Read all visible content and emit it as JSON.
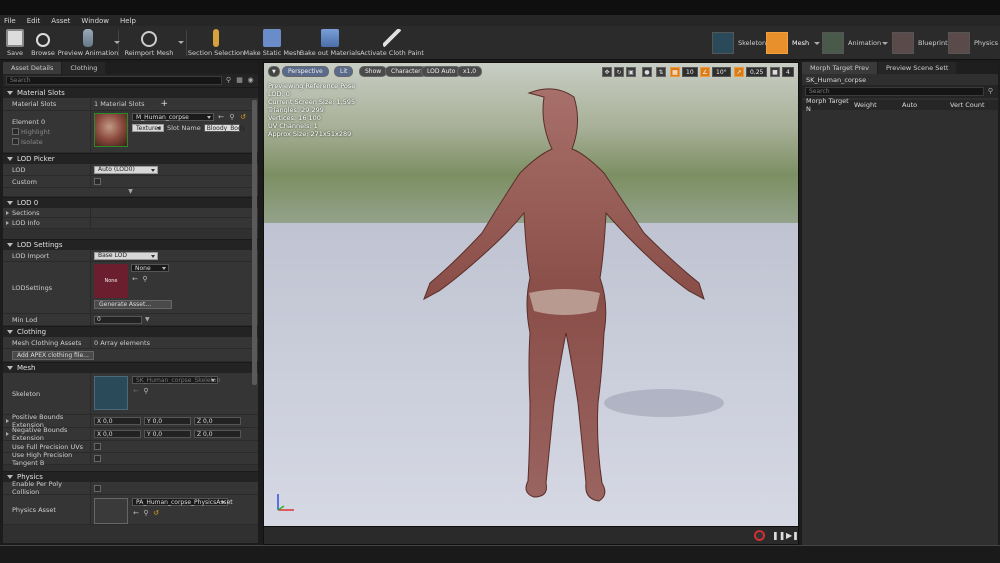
{
  "menu": [
    "File",
    "Edit",
    "Asset",
    "Window",
    "Help"
  ],
  "toolbar": {
    "save": "Save",
    "browse": "Browse",
    "preview_animation": "Preview Animation",
    "reimport_mesh": "Reimport Mesh",
    "section_selection": "Section Selection",
    "make_static_mesh": "Make Static Mesh",
    "bake_out_materials": "Bake out Materials",
    "activate_cloth_paint": "Activate Cloth Paint"
  },
  "modes": [
    "Skeleton",
    "Mesh",
    "Animation",
    "Blueprint",
    "Physics"
  ],
  "active_mode": "Mesh",
  "left_panel": {
    "tabs": [
      "Asset Details",
      "Clothing"
    ],
    "search_placeholder": "Search",
    "material_slots": {
      "header": "Material Slots",
      "label": "Material Slots",
      "count": "1 Material Slots",
      "element_label": "Element 0",
      "highlight": "Highlight",
      "isolate": "Isolate",
      "material": "M_Human_corpse",
      "textures": "Textures",
      "slot_name_label": "Slot Name",
      "slot_name": "Bloody_Body"
    },
    "lod_picker": {
      "header": "LOD Picker",
      "lod_label": "LOD",
      "lod_value": "Auto (LOD0)",
      "custom_label": "Custom"
    },
    "lod0": {
      "header": "LOD 0",
      "sections": "Sections",
      "lod_info": "LOD Info"
    },
    "lod_settings": {
      "header": "LOD Settings",
      "lod_import_label": "LOD Import",
      "lod_import_value": "Base LOD",
      "lodsettings_label": "LODSettings",
      "lodsettings_thumb": "None",
      "lodsettings_value": "None",
      "generate_asset": "Generate Asset...",
      "min_lod_label": "Min Lod",
      "min_lod_value": "0"
    },
    "clothing": {
      "header": "Clothing",
      "mesh_clothing_assets_label": "Mesh Clothing Assets",
      "mesh_clothing_assets_value": "0 Array elements",
      "add_apex": "Add APEX clothing file..."
    },
    "mesh": {
      "header": "Mesh",
      "skeleton_label": "Skeleton",
      "skeleton_value": "SK_Human_corpse_Skeleton",
      "pos_bounds_label": "Positive Bounds Extension",
      "neg_bounds_label": "Negative Bounds Extension",
      "x": "X 0,0",
      "y": "Y 0,0",
      "z": "Z 0,0",
      "full_precision_uvs": "Use Full Precision UVs",
      "high_precision_tangent": "Use High Precision Tangent B"
    },
    "physics": {
      "header": "Physics",
      "per_poly_collision": "Enable Per Poly Collision",
      "physics_asset_label": "Physics Asset",
      "physics_asset_value": "PA_Human_corpse_PhysicsAsset"
    }
  },
  "viewport": {
    "perspective": "Perspective",
    "lit": "Lit",
    "show": "Show",
    "character": "Character",
    "lod_auto": "LOD Auto",
    "speed": "x1,0",
    "info_lines": [
      "Previewing Reference Pose",
      "LOD: 0",
      "Current Screen Size: 1,595",
      "Triangles: 29 299",
      "Vertices: 16 100",
      "UV Channels: 1",
      "Approx Size: 271x51x289"
    ],
    "grid_snap": "10",
    "rot_snap": "10°",
    "scale_snap": "0,25",
    "cam_speed": "4"
  },
  "right_panel": {
    "tabs": [
      "Morph Target Prev",
      "Preview Scene Sett"
    ],
    "asset_name": "SK_Human_corpse",
    "search_placeholder": "Search",
    "columns": [
      "Morph Target N",
      "Weight",
      "Auto",
      "Vert Count"
    ]
  }
}
